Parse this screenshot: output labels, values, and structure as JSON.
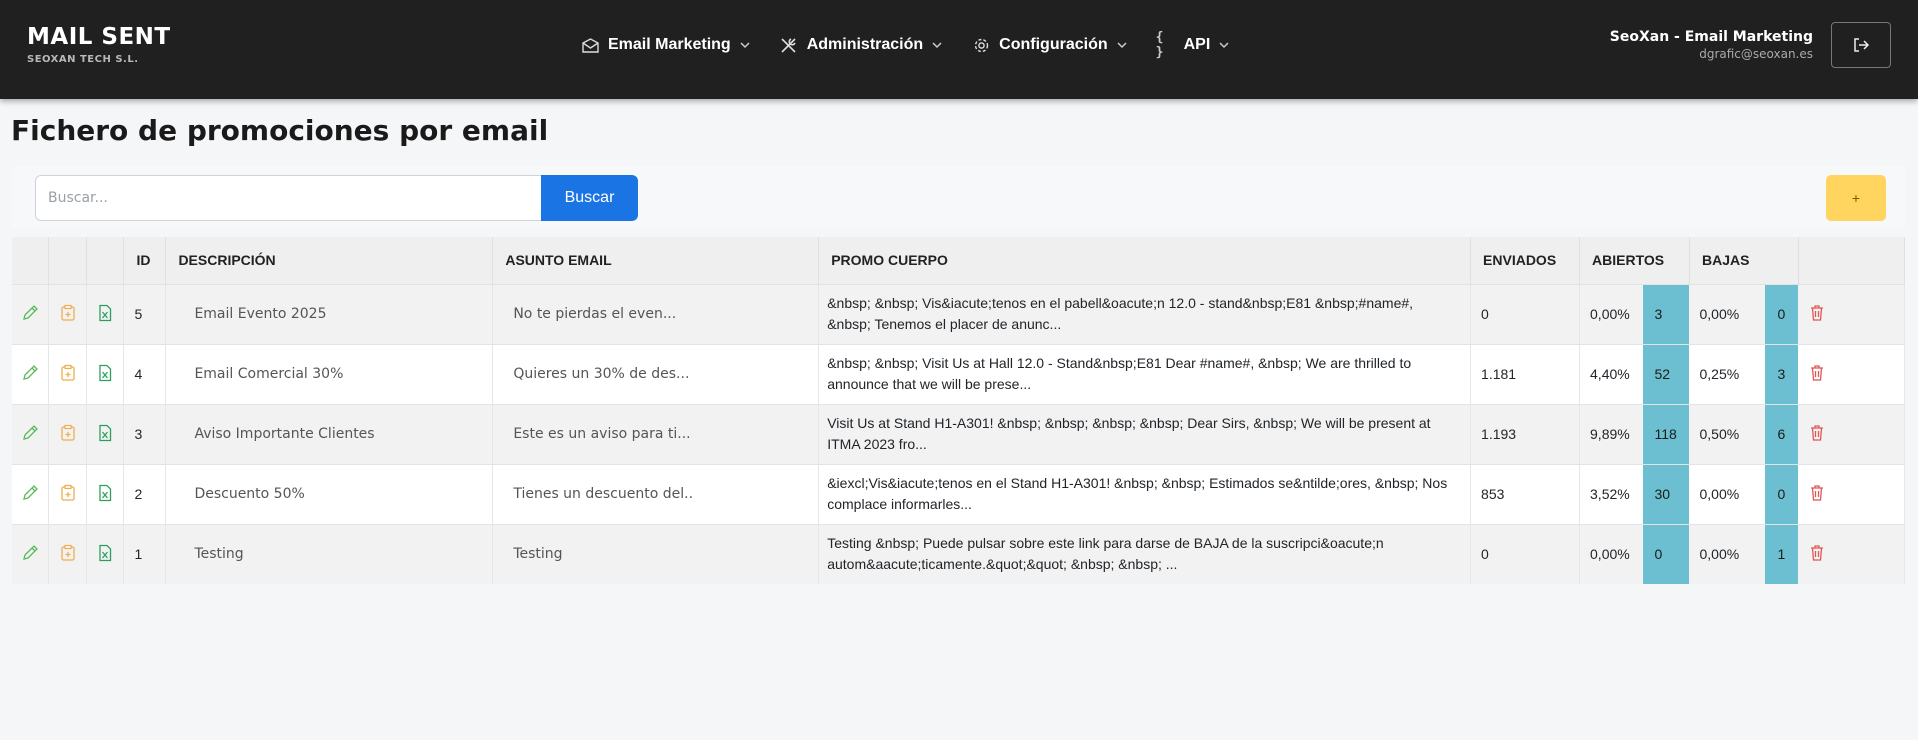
{
  "brand": {
    "title": "MAIL SENT",
    "subtitle": "SEOXAN TECH S.L."
  },
  "nav": [
    {
      "label": "Email Marketing",
      "icon": "envelope-icon"
    },
    {
      "label": "Administración",
      "icon": "tools-icon"
    },
    {
      "label": "Configuración",
      "icon": "gear-icon"
    },
    {
      "label": "API",
      "icon": "braces-icon"
    }
  ],
  "user": {
    "name": "SeoXan - Email Marketing",
    "email": "dgrafic@seoxan.es"
  },
  "page": {
    "title": "Fichero de promociones por email"
  },
  "search": {
    "placeholder": "Buscar...",
    "button": "Buscar",
    "add_label": "+"
  },
  "table": {
    "headers": {
      "id": "ID",
      "descripcion": "DESCRIPCIÓN",
      "asunto": "ASUNTO EMAIL",
      "cuerpo": "PROMO CUERPO",
      "enviados": "ENVIADOS",
      "abiertos": "ABIERTOS",
      "bajas": "BAJAS"
    },
    "rows": [
      {
        "id": "5",
        "descripcion": "Email Evento 2025",
        "asunto": "No te pierdas el even...",
        "cuerpo": "&nbsp; &nbsp; Vis&iacute;tenos en el pabell&oacute;n 12.0 - stand&nbsp;E81 &nbsp;#name#, &nbsp; Tenemos el placer de anunc...",
        "enviados": "0",
        "abiertos_pct": "0,00%",
        "abiertos": "3",
        "bajas_pct": "0,00%",
        "bajas": "0"
      },
      {
        "id": "4",
        "descripcion": "Email Comercial 30%",
        "asunto": "Quieres un 30% de des...",
        "cuerpo": "&nbsp; &nbsp; Visit Us at Hall 12.0 - Stand&nbsp;E81 Dear #name#, &nbsp; We are thrilled to announce that we will be prese...",
        "enviados": "1.181",
        "abiertos_pct": "4,40%",
        "abiertos": "52",
        "bajas_pct": "0,25%",
        "bajas": "3"
      },
      {
        "id": "3",
        "descripcion": "Aviso Importante Clientes",
        "asunto": "Este es un aviso para ti...",
        "cuerpo": "Visit Us at Stand H1-A301! &nbsp; &nbsp; &nbsp; &nbsp; Dear Sirs, &nbsp; We will be present at ITMA 2023 fro...",
        "enviados": "1.193",
        "abiertos_pct": "9,89%",
        "abiertos": "118",
        "bajas_pct": "0,50%",
        "bajas": "6"
      },
      {
        "id": "2",
        "descripcion": "Descuento 50%",
        "asunto": "Tienes un descuento del..",
        "cuerpo": "&iexcl;Vis&iacute;tenos en el Stand H1-A301! &nbsp; &nbsp; Estimados se&ntilde;ores, &nbsp; Nos complace informarles...",
        "enviados": "853",
        "abiertos_pct": "3,52%",
        "abiertos": "30",
        "bajas_pct": "0,00%",
        "bajas": "0"
      },
      {
        "id": "1",
        "descripcion": "Testing",
        "asunto": "Testing",
        "cuerpo": "Testing &nbsp; Puede pulsar sobre este link para darse de BAJA de la suscripci&oacute;n autom&aacute;ticamente.&quot;&quot; &nbsp; &nbsp; ...",
        "enviados": "0",
        "abiertos_pct": "0,00%",
        "abiertos": "0",
        "bajas_pct": "0,00%",
        "bajas": "1"
      }
    ]
  },
  "colors": {
    "navbar": "#202020",
    "primary": "#1b74e4",
    "warning": "#ffd560",
    "info": "#6bbfd0",
    "edit": "#5cb85c",
    "copy": "#f0ad4e",
    "excel": "#2e9e5e",
    "delete": "#e05555"
  }
}
